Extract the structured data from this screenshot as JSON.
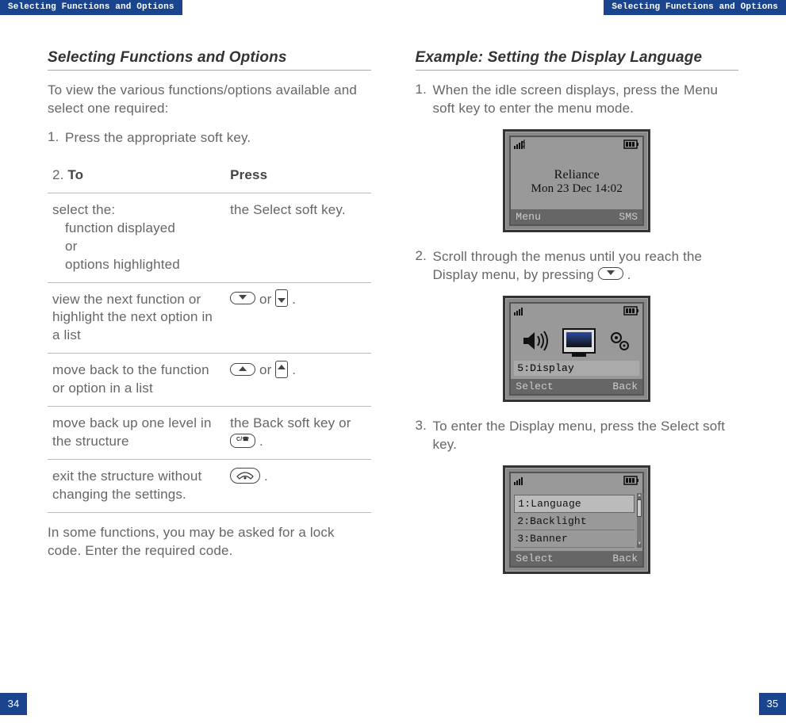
{
  "headers": {
    "left": "Selecting Functions and Options",
    "right": "Selecting Functions and Options"
  },
  "page_numbers": {
    "left": "34",
    "right": "35"
  },
  "left_page": {
    "title": "Selecting Functions and Options",
    "intro": "To view the various functions/options available and select one required:",
    "step1_num": "1.",
    "step1_txt": "Press the appropriate soft key.",
    "step2_num": "2.",
    "table": {
      "col1": "To",
      "col2": "Press",
      "r1c1a": "select the:",
      "r1c1b": "function displayed",
      "r1c1c": "or",
      "r1c1d": "options highlighted",
      "r1c2": "the ",
      "r1c2b": "Select",
      "r1c2c": " soft key.",
      "r2c1": "view the next function or highlight the next option in a list",
      "r2_mid": " or ",
      "r3c1": "move back to the function or option in a list",
      "r3_mid": " or ",
      "r4c1": "move back up one level in the structure",
      "r4c2a": "the ",
      "r4c2b": "Back",
      "r4c2c": " soft key or ",
      "r5c1": "exit the structure without changing the settings."
    },
    "footer": "In some functions, you may be asked for a lock code. Enter the required code."
  },
  "right_page": {
    "title": "Example: Setting the Display Language",
    "s1_num": "1.",
    "s1_a": "When the idle screen displays, press the ",
    "s1_b": "Menu",
    "s1_c": " soft key to enter the menu mode.",
    "s2_num": "2.",
    "s2_a": "Scroll through the menus until you reach the ",
    "s2_b": "Display",
    "s2_c": " menu, by pressing ",
    "s3_num": "3.",
    "s3_a": "To enter the ",
    "s3_b": "Display",
    "s3_c": " menu, press the ",
    "s3_d": "Select",
    "s3_e": " soft key.",
    "phone1": {
      "line1": "Reliance",
      "line2": "Mon 23 Dec 14:02",
      "sk_l": "Menu",
      "sk_r": "SMS"
    },
    "phone2": {
      "label": "5:Display",
      "sk_l": "Select",
      "sk_r": "Back"
    },
    "phone3": {
      "i1": "1:Language",
      "i2": "2:Backlight",
      "i3": "3:Banner",
      "sk_l": "Select",
      "sk_r": "Back"
    }
  }
}
